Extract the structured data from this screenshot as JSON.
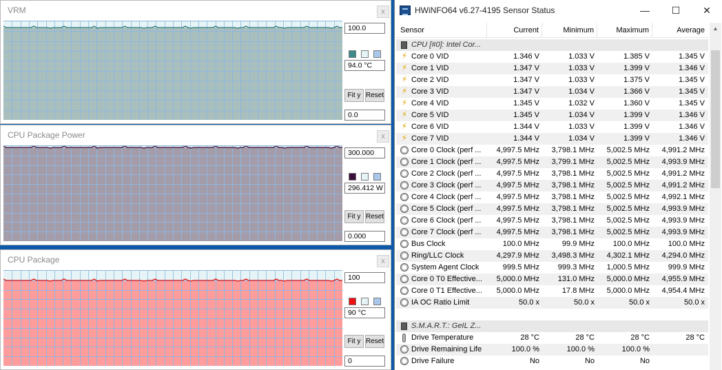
{
  "graphs": [
    {
      "title": "VRM",
      "close": "x",
      "max": "100.0",
      "current": "94.0 °C",
      "min": "0.0",
      "fit_label": "Fit y",
      "reset_label": "Reset",
      "plot_color": "#a9bfbd",
      "swatch_color": "#3c8b89",
      "line_color": "#2f7d7b",
      "level": 0.94
    },
    {
      "title": "CPU Package Power",
      "close": "x",
      "max": "300.000",
      "current": "296.412 W",
      "min": "0.000",
      "fit_label": "Fit y",
      "reset_label": "Reset",
      "plot_color": "#a49ca8",
      "swatch_color": "#3a0f3a",
      "line_color": "#3a0f3a",
      "level": 0.988
    },
    {
      "title": "CPU Package",
      "close": "x",
      "max": "100",
      "current": "90 °C",
      "min": "0",
      "fit_label": "Fit y",
      "reset_label": "Reset",
      "plot_color": "#ff9c9c",
      "swatch_color": "#ee1111",
      "line_color": "#e11010",
      "level": 0.9
    }
  ],
  "hwinfo": {
    "title": "HWiNFO64 v6.27-4195 Sensor Status",
    "minimize": "—",
    "maximize": "☐",
    "close": "✕",
    "columns": [
      "Sensor",
      "Current",
      "Minimum",
      "Maximum",
      "Average"
    ],
    "rows": [
      {
        "type": "group",
        "icon": "chip",
        "name": "CPU [#0]: Intel Cor..."
      },
      {
        "icon": "bolt",
        "name": "Core 0 VID",
        "cur": "1.346 V",
        "min": "1.033 V",
        "max": "1.385 V",
        "avg": "1.345 V"
      },
      {
        "icon": "bolt",
        "name": "Core 1 VID",
        "cur": "1.347 V",
        "min": "1.033 V",
        "max": "1.399 V",
        "avg": "1.346 V"
      },
      {
        "icon": "bolt",
        "name": "Core 2 VID",
        "cur": "1.347 V",
        "min": "1.033 V",
        "max": "1.375 V",
        "avg": "1.345 V"
      },
      {
        "icon": "bolt",
        "name": "Core 3 VID",
        "cur": "1.347 V",
        "min": "1.034 V",
        "max": "1.366 V",
        "avg": "1.345 V"
      },
      {
        "icon": "bolt",
        "name": "Core 4 VID",
        "cur": "1.345 V",
        "min": "1.032 V",
        "max": "1.360 V",
        "avg": "1.345 V"
      },
      {
        "icon": "bolt",
        "name": "Core 5 VID",
        "cur": "1.345 V",
        "min": "1.034 V",
        "max": "1.399 V",
        "avg": "1.346 V"
      },
      {
        "icon": "bolt",
        "name": "Core 6 VID",
        "cur": "1.344 V",
        "min": "1.033 V",
        "max": "1.399 V",
        "avg": "1.346 V"
      },
      {
        "icon": "bolt",
        "name": "Core 7 VID",
        "cur": "1.344 V",
        "min": "1.034 V",
        "max": "1.399 V",
        "avg": "1.346 V"
      },
      {
        "icon": "clock",
        "name": "Core 0 Clock (perf ...",
        "cur": "4,997.5 MHz",
        "min": "3,798.1 MHz",
        "max": "5,002.5 MHz",
        "avg": "4,991.2 MHz"
      },
      {
        "icon": "clock",
        "name": "Core 1 Clock (perf ...",
        "cur": "4,997.5 MHz",
        "min": "3,799.1 MHz",
        "max": "5,002.5 MHz",
        "avg": "4,993.9 MHz"
      },
      {
        "icon": "clock",
        "name": "Core 2 Clock (perf ...",
        "cur": "4,997.5 MHz",
        "min": "3,798.1 MHz",
        "max": "5,002.5 MHz",
        "avg": "4,991.2 MHz"
      },
      {
        "icon": "clock",
        "name": "Core 3 Clock (perf ...",
        "cur": "4,997.5 MHz",
        "min": "3,798.1 MHz",
        "max": "5,002.5 MHz",
        "avg": "4,991.2 MHz"
      },
      {
        "icon": "clock",
        "name": "Core 4 Clock (perf ...",
        "cur": "4,997.5 MHz",
        "min": "3,798.1 MHz",
        "max": "5,002.5 MHz",
        "avg": "4,992.1 MHz"
      },
      {
        "icon": "clock",
        "name": "Core 5 Clock (perf ...",
        "cur": "4,997.5 MHz",
        "min": "3,798.1 MHz",
        "max": "5,002.5 MHz",
        "avg": "4,993.9 MHz"
      },
      {
        "icon": "clock",
        "name": "Core 6 Clock (perf ...",
        "cur": "4,997.5 MHz",
        "min": "3,798.1 MHz",
        "max": "5,002.5 MHz",
        "avg": "4,993.9 MHz"
      },
      {
        "icon": "clock",
        "name": "Core 7 Clock (perf ...",
        "cur": "4,997.5 MHz",
        "min": "3,798.1 MHz",
        "max": "5,002.5 MHz",
        "avg": "4,993.9 MHz"
      },
      {
        "icon": "clock",
        "name": "Bus Clock",
        "cur": "100.0 MHz",
        "min": "99.9 MHz",
        "max": "100.0 MHz",
        "avg": "100.0 MHz"
      },
      {
        "icon": "clock",
        "name": "Ring/LLC Clock",
        "cur": "4,297.9 MHz",
        "min": "3,498.3 MHz",
        "max": "4,302.1 MHz",
        "avg": "4,294.0 MHz"
      },
      {
        "icon": "clock",
        "name": "System Agent Clock",
        "cur": "999.5 MHz",
        "min": "999.3 MHz",
        "max": "1,000.5 MHz",
        "avg": "999.9 MHz"
      },
      {
        "icon": "clock",
        "name": "Core 0 T0 Effective...",
        "cur": "5,000.0 MHz",
        "min": "131.0 MHz",
        "max": "5,000.0 MHz",
        "avg": "4,955.9 MHz"
      },
      {
        "icon": "clock",
        "name": "Core 0 T1 Effective...",
        "cur": "5,000.0 MHz",
        "min": "17.8 MHz",
        "max": "5,000.0 MHz",
        "avg": "4,954.4 MHz"
      },
      {
        "icon": "clock",
        "name": "IA OC Ratio Limit",
        "cur": "50.0 x",
        "min": "50.0 x",
        "max": "50.0 x",
        "avg": "50.0 x"
      },
      {
        "type": "blank"
      },
      {
        "type": "group",
        "icon": "chip",
        "name": "S.M.A.R.T.: GeIL Z..."
      },
      {
        "icon": "therm",
        "name": "Drive Temperature",
        "cur": "28 °C",
        "min": "28 °C",
        "max": "28 °C",
        "avg": "28 °C"
      },
      {
        "icon": "clock",
        "name": "Drive Remaining Life",
        "cur": "100.0 %",
        "min": "100.0 %",
        "max": "100.0 %",
        "avg": ""
      },
      {
        "icon": "clock",
        "name": "Drive Failure",
        "cur": "No",
        "min": "No",
        "max": "No",
        "avg": ""
      }
    ]
  }
}
